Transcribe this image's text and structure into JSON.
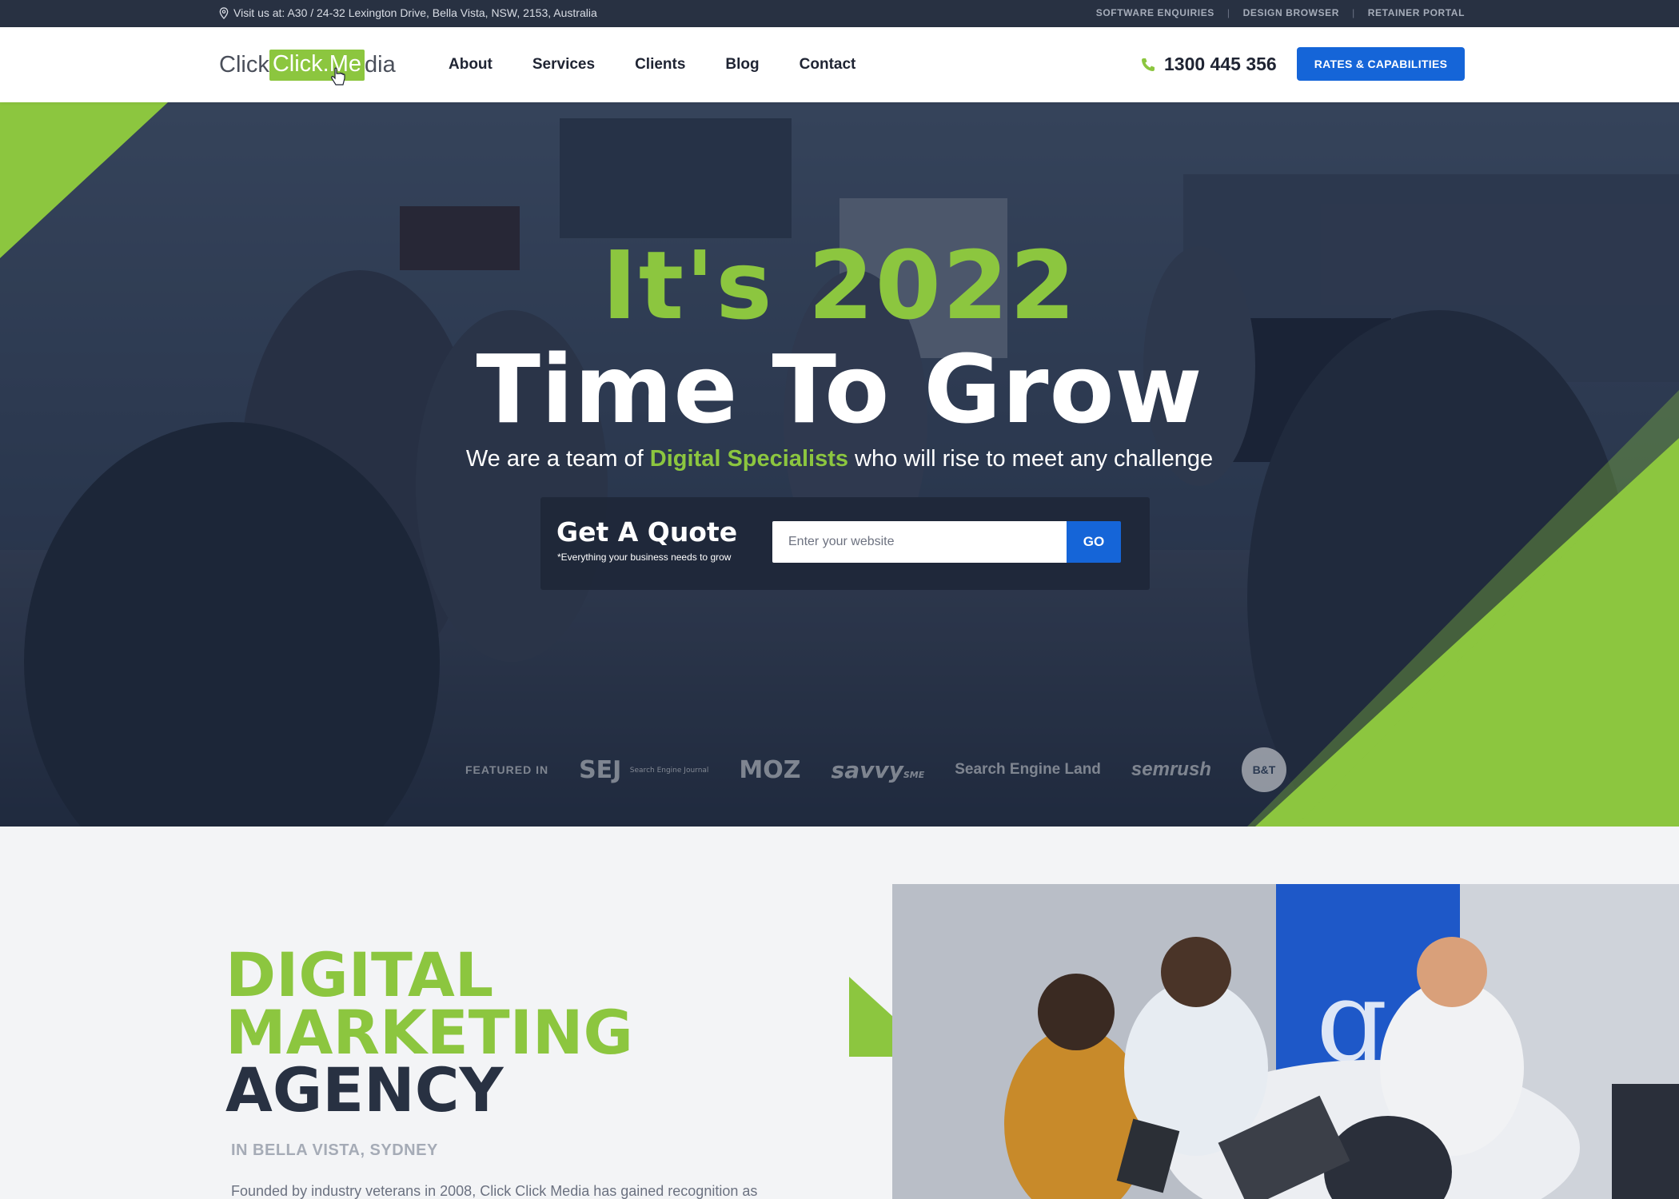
{
  "topbar": {
    "address": "Visit us at: A30 / 24-32 Lexington Drive, Bella Vista, NSW, 2153, Australia",
    "links": [
      "SOFTWARE ENQUIRIES",
      "DESIGN BROWSER",
      "RETAINER PORTAL"
    ],
    "separator": "|"
  },
  "header": {
    "logo": {
      "part1": "Click",
      "part2": "Click.Me",
      "part3": "dia"
    },
    "nav": [
      "About",
      "Services",
      "Clients",
      "Blog",
      "Contact"
    ],
    "phone": "1300 445 356",
    "cta": "RATES & CAPABILITIES"
  },
  "hero": {
    "headline_1": "It's 2022",
    "headline_2": "Time To Grow",
    "tagline_pre": "We are a team of ",
    "tagline_highlight": "Digital Specialists",
    "tagline_post": " who will rise to meet any challenge",
    "quote": {
      "title": "Get A Quote",
      "subtitle": "*Everything your business needs to grow",
      "input_placeholder": "Enter your website",
      "button": "GO"
    },
    "featured": {
      "label": "FEATURED IN",
      "logos": {
        "sej": "SEJ",
        "sej_small": "Search Engine Journal",
        "moz": "MOZ",
        "savvy": "savvy",
        "savvy_small": "SME",
        "sel": "Search Engine Land",
        "semrush": "semrush",
        "bt": "B&T"
      }
    }
  },
  "intro": {
    "title_line1": "DIGITAL",
    "title_line2": "MARKETING",
    "title_line3": "AGENCY",
    "location": "IN BELLA VISTA, SYDNEY",
    "body": "Founded by industry veterans in 2008, Click Click Media has gained recognition as"
  },
  "colors": {
    "brand_green": "#8cc63f",
    "brand_blue": "#1565d8",
    "dark_navy": "#283142"
  }
}
